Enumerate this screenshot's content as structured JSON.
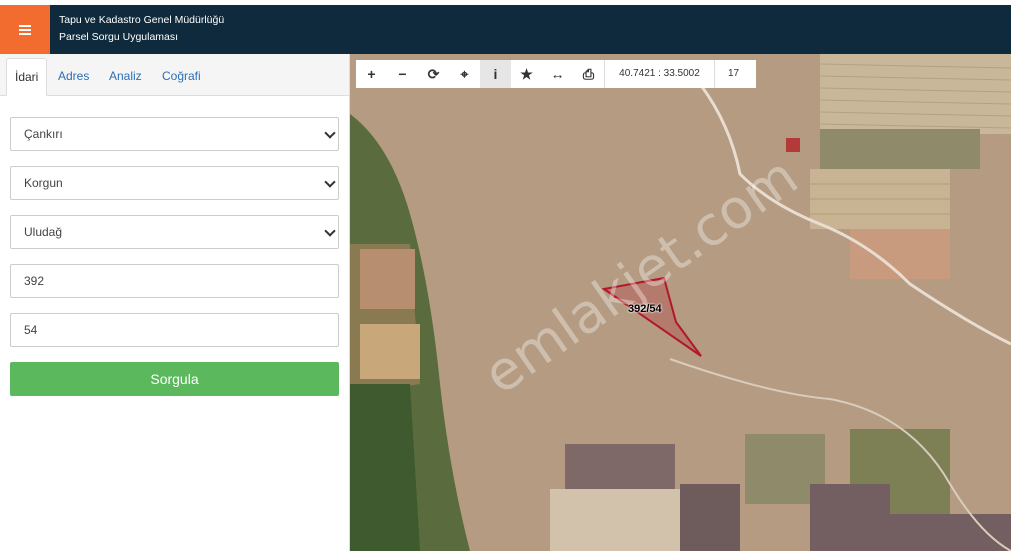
{
  "header": {
    "title_line1": "Tapu ve Kadastro Genel Müdürlüğü",
    "title_line2": "Parsel Sorgu Uygulaması",
    "menu_icon": "hamburger-menu-icon",
    "accent_color": "#f26c2f",
    "bar_color": "#0e2a3c"
  },
  "side": {
    "tabs": [
      {
        "label": "İdari"
      },
      {
        "label": "Adres"
      },
      {
        "label": "Analiz"
      },
      {
        "label": "Coğrafi"
      }
    ],
    "province": "Çankırı",
    "district": "Korgun",
    "neighborhood": "Uludağ",
    "block": "392",
    "parcel": "54",
    "submit_label": "Sorgula",
    "submit_color": "#5cb85c"
  },
  "map": {
    "toolbar": [
      {
        "icon": "zoom-in-icon",
        "glyph": "+"
      },
      {
        "icon": "zoom-out-icon",
        "glyph": "−"
      },
      {
        "icon": "refresh-icon",
        "glyph": "⟳"
      },
      {
        "icon": "locate-icon",
        "glyph": "⌖"
      },
      {
        "icon": "info-icon",
        "glyph": "i"
      },
      {
        "icon": "star-icon",
        "glyph": "★"
      },
      {
        "icon": "measure-icon",
        "glyph": "↔"
      },
      {
        "icon": "print-icon",
        "glyph": "⎙"
      }
    ],
    "coordinates": "40.7421 : 33.5002",
    "zoom_level": "17",
    "parcel_label": "392/54",
    "watermark": "emlakjet.com",
    "parcel_color": "#b2182b"
  }
}
